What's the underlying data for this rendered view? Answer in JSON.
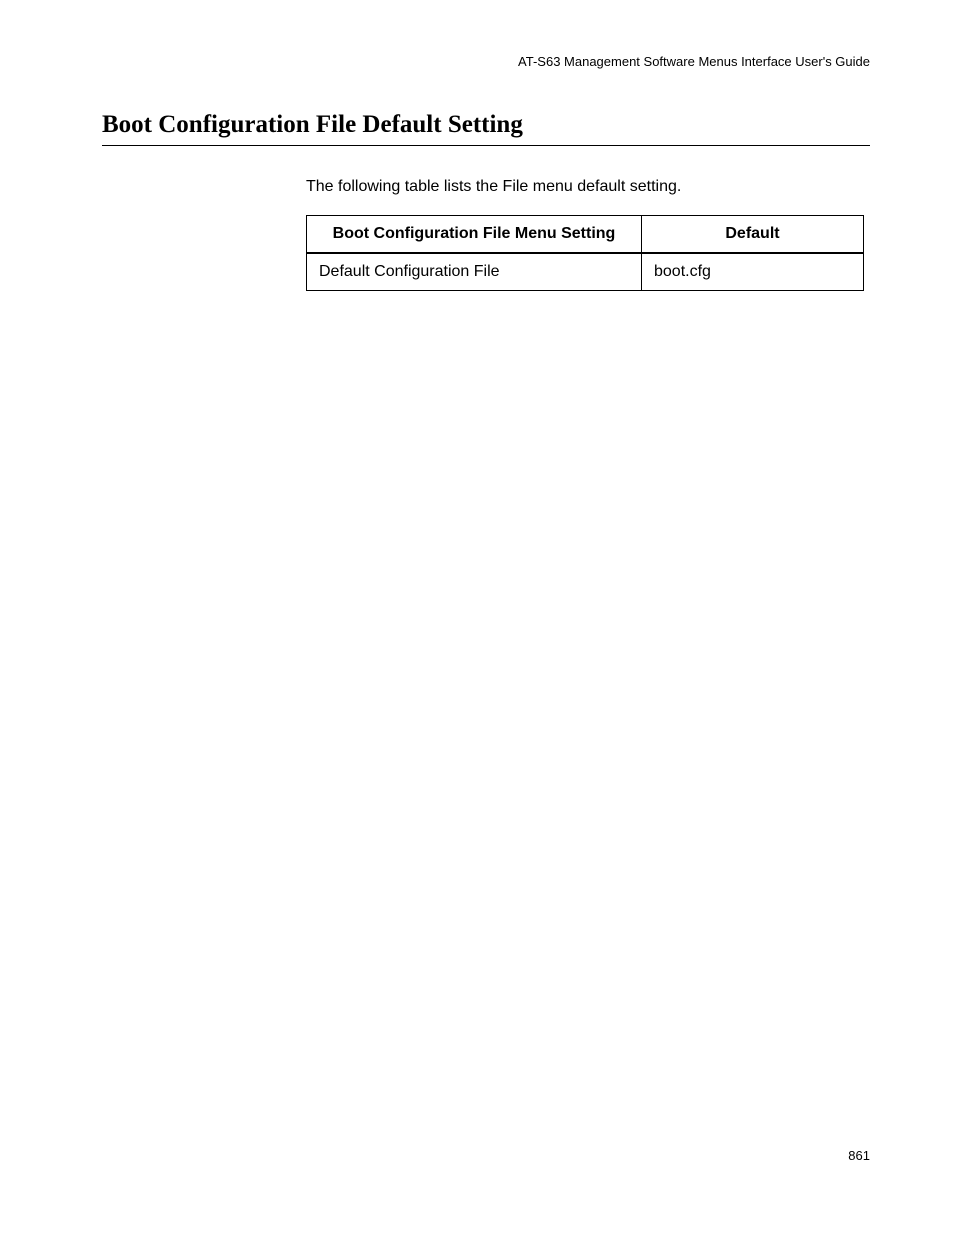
{
  "header": {
    "guide_title": "AT-S63 Management Software Menus Interface User's Guide"
  },
  "section": {
    "title": "Boot Configuration File Default Setting",
    "intro": "The following table lists the File menu default setting."
  },
  "table": {
    "headers": {
      "col1": "Boot Configuration File Menu Setting",
      "col2": "Default"
    },
    "rows": [
      {
        "setting": "Default Configuration File",
        "default": "boot.cfg"
      }
    ]
  },
  "footer": {
    "page_number": "861"
  }
}
